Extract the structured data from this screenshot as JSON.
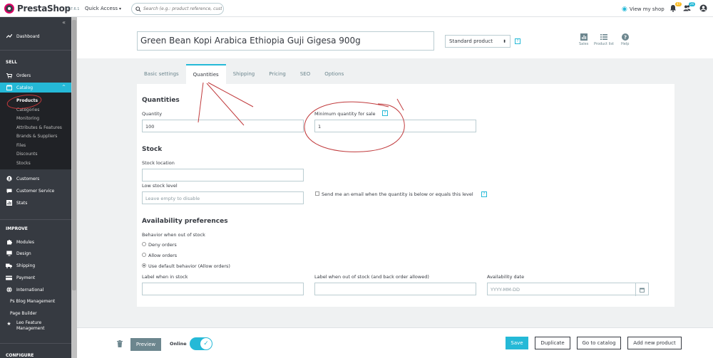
{
  "header": {
    "logo_text": "PrestaShop",
    "version": "1.7.6.1",
    "quick_access": "Quick Access",
    "search_placeholder": "Search (e.g.: product reference, custome",
    "view_shop": "View my shop",
    "orders_badge": "47",
    "customers_badge": "26"
  },
  "sidebar": {
    "dashboard": "Dashboard",
    "sell_section": "SELL",
    "orders": "Orders",
    "catalog": "Catalog",
    "catalog_sub": [
      "Products",
      "Categories",
      "Monitoring",
      "Attributes & Features",
      "Brands & Suppliers",
      "Files",
      "Discounts",
      "Stocks"
    ],
    "customers": "Customers",
    "customer_service": "Customer Service",
    "stats": "Stats",
    "improve_section": "IMPROVE",
    "modules": "Modules",
    "design": "Design",
    "shipping": "Shipping",
    "payment": "Payment",
    "international": "International",
    "ps_blog": "Ps Blog Management",
    "page_builder": "Page Builder",
    "leo_feature_1": "Leo Feature",
    "leo_feature_2": "Management",
    "configure_section": "CONFIGURE"
  },
  "product": {
    "name": "Green Bean Kopi Arabica Ethiopia Guji Gigesa 900g",
    "type": "Standard product",
    "tools": {
      "sales": "Sales",
      "product_list": "Product list",
      "help": "Help"
    }
  },
  "tabs": [
    "Basic settings",
    "Quantities",
    "Shipping",
    "Pricing",
    "SEO",
    "Options"
  ],
  "quantities": {
    "title": "Quantities",
    "quantity_label": "Quantity",
    "quantity_value": "100",
    "min_qty_label": "Minimum quantity for sale",
    "min_qty_value": "1"
  },
  "stock": {
    "title": "Stock",
    "location_label": "Stock location",
    "low_level_label": "Low stock level",
    "low_level_placeholder": "Leave empty to disable",
    "email_label": "Send me an email when the quantity is below or equals this level"
  },
  "availability": {
    "title": "Availability preferences",
    "behavior_label": "Behavior when out of stock",
    "options": [
      "Deny orders",
      "Allow orders",
      "Use default behavior (Allow orders)"
    ],
    "selected_index": 2,
    "in_stock_label": "Label when in stock",
    "out_stock_label": "Label when out of stock (and back order allowed)",
    "date_label": "Availability date",
    "date_placeholder": "YYYY-MM-DD"
  },
  "footer": {
    "preview": "Preview",
    "online": "Online",
    "save": "Save",
    "duplicate": "Duplicate",
    "go_to_catalog": "Go to catalog",
    "add_new": "Add new product"
  },
  "colors": {
    "accent": "#25b9d7",
    "sidebar": "#363a41",
    "annotation": "#c0393b"
  }
}
